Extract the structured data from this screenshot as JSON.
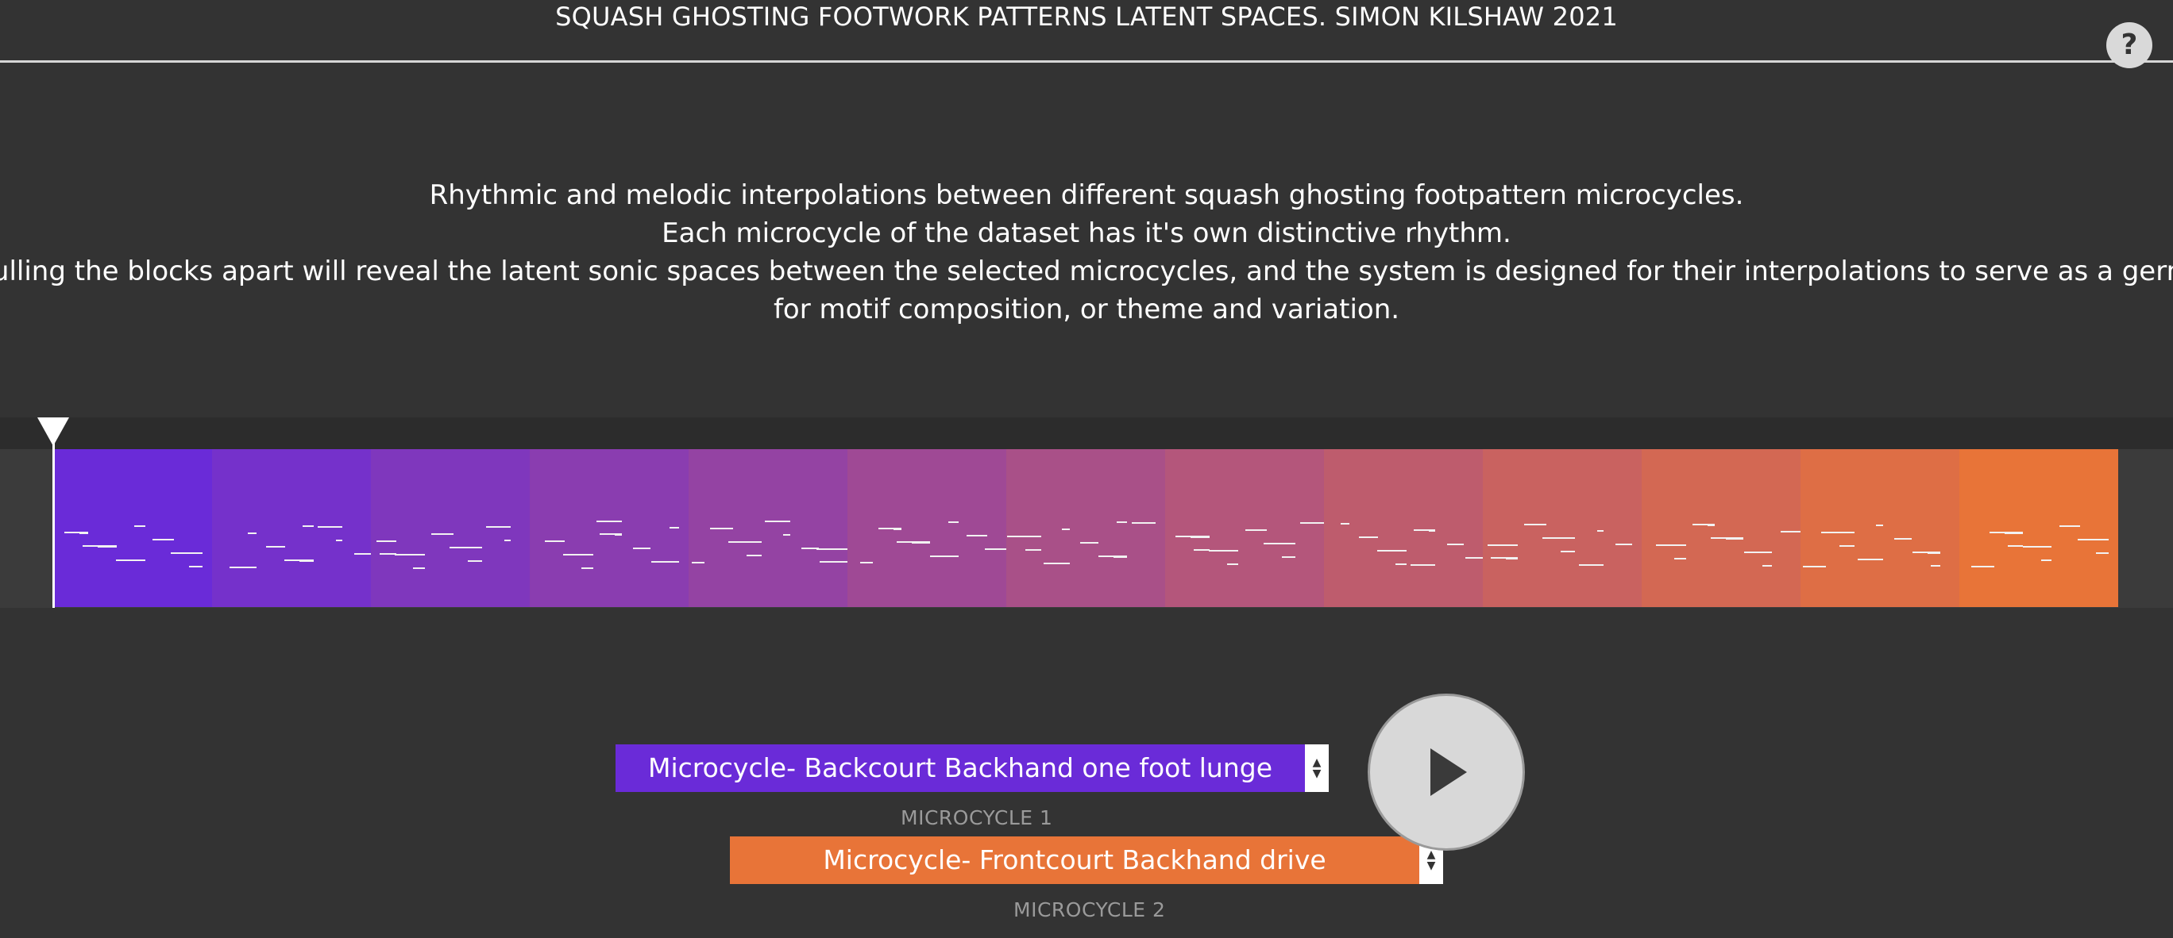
{
  "header": {
    "title": "SQUASH GHOSTING FOOTWORK PATTERNS LATENT SPACES. SIMON KILSHAW 2021",
    "help_label": "?"
  },
  "description": {
    "lines": [
      "Rhythmic and melodic interpolations between different squash ghosting footpattern microcycles.",
      "Each microcycle of the dataset has it's own distinctive rhythm.",
      "Pulling the blocks apart will reveal the latent sonic spaces between the selected microcycles, and the system is designed for their interpolations to serve as a germinal input",
      "for motif composition, or theme and variation."
    ]
  },
  "sequencer": {
    "block_count": 13,
    "start_color": "#6a2bd8",
    "end_color": "#e87438"
  },
  "controls": {
    "microcycle1": {
      "value": "Microcycle- Backcourt Backhand one foot lunge",
      "label": "MICROCYCLE 1",
      "color": "#6a2bd8"
    },
    "microcycle2": {
      "value": "Microcycle- Frontcourt Backhand drive",
      "label": "MICROCYCLE 2",
      "color": "#e87438"
    },
    "play_icon": "play-icon"
  }
}
